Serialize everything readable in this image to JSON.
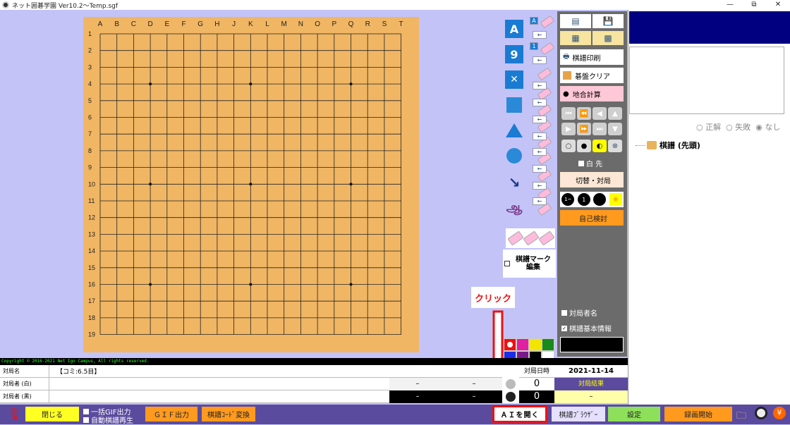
{
  "window": {
    "title": "ネット囲碁学園 Ver10.2〜Temp.sgf",
    "controls": [
      "—",
      "⧉",
      "✕"
    ]
  },
  "board": {
    "columns": [
      "A",
      "B",
      "C",
      "D",
      "E",
      "F",
      "G",
      "H",
      "J",
      "K",
      "L",
      "M",
      "N",
      "O",
      "P",
      "Q",
      "R",
      "S",
      "T"
    ],
    "rows": [
      "1",
      "2",
      "3",
      "4",
      "5",
      "6",
      "7",
      "8",
      "9",
      "10",
      "11",
      "12",
      "13",
      "14",
      "15",
      "16",
      "17",
      "18",
      "19"
    ],
    "star_points": [
      [
        "D",
        4
      ],
      [
        "K",
        4
      ],
      [
        "Q",
        4
      ],
      [
        "D",
        10
      ],
      [
        "K",
        10
      ],
      [
        "Q",
        10
      ],
      [
        "D",
        16
      ],
      [
        "K",
        16
      ],
      [
        "Q",
        16
      ]
    ]
  },
  "tools": {
    "letter_a": "A",
    "number_9": "9",
    "letter_mini": "A",
    "number_mini": "1",
    "back_arrow": "←"
  },
  "mark_edit": {
    "label_line1": "棋譜マーク",
    "label_line2": "編集"
  },
  "callout": {
    "label": "クリック"
  },
  "right_panel": {
    "print_label": "棋譜印刷",
    "clear_label": "碁盤クリア",
    "count_label": "地合計算",
    "white_first_label": "白 先",
    "switch_label": "切替・対局",
    "self_review_label": "自己検討",
    "player_name_label": "対局者名",
    "basic_info_label": "棋譜基本情報",
    "number_stone": "1~",
    "number_one": "1"
  },
  "side": {
    "radio_correct": "正解",
    "radio_fail": "失敗",
    "radio_none": "なし",
    "tree_label": "棋譜 (先頭)"
  },
  "copyright": "Copyright © 2016-2021 Net Igo Campus, All rights reserved.",
  "game_info": {
    "game_name_label": "対局名",
    "game_name_value": "【コミ:6.5目】",
    "white_label": "対局者 (白)",
    "black_label": "対局者 (黒)",
    "date_label": "対局日時",
    "date_value": "2021-11-14",
    "result_label": "対局結果",
    "result_value": "–",
    "dash": "–",
    "white_captures": "0",
    "black_captures": "0"
  },
  "bottom_bar": {
    "close_label": "閉じる",
    "gif_batch_label": "一括GIF出力",
    "auto_play_label": "自動棋譜再生",
    "gif_output_label": "ＧＩＦ出力",
    "code_convert_label": "棋譜ｺｰﾄﾞ変換",
    "ai_open_label": "ＡＩを開く",
    "browser_label": "棋譜ﾌﾞﾗｳｻﾞｰ",
    "settings_label": "設定",
    "record_label": "録画開始"
  }
}
